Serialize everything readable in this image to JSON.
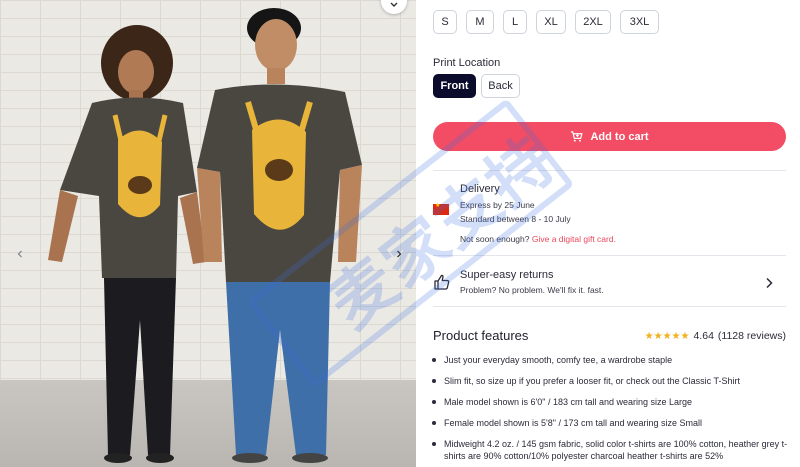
{
  "sizes": [
    "S",
    "M",
    "L",
    "XL",
    "2XL",
    "3XL"
  ],
  "print_location": {
    "label": "Print Location",
    "options": [
      "Front",
      "Back"
    ],
    "selected": "Front"
  },
  "cart": {
    "label": "Add to cart"
  },
  "delivery": {
    "title": "Delivery",
    "express": "Express by 25 June",
    "standard": "Standard between 8 - 10 July",
    "not_soon": "Not soon enough?",
    "gift_link": "Give a digital gift card."
  },
  "returns": {
    "title": "Super-easy returns",
    "subtitle": "Problem? No problem. We'll fix it. fast."
  },
  "features": {
    "title": "Product features",
    "rating": "4.64",
    "reviews": "(1128 reviews)",
    "stars": "★★★★★",
    "items": [
      "Just your everyday smooth, comfy tee, a wardrobe staple",
      "Slim fit, so size up if you prefer a looser fit, or check out the Classic T-Shirt",
      "Male model shown is 6'0\" / 183 cm tall and wearing size Large",
      "Female model shown is 5'8\" / 173 cm tall and wearing size Small",
      "Midweight 4.2 oz. / 145 gsm fabric, solid color t-shirts are 100% cotton, heather grey t-shirts are 90% cotton/10% polyester charcoal heather t-shirts are 52%"
    ]
  },
  "watermark": "麦家支持",
  "colors": {
    "accent": "#f24d64",
    "selected": "#0b0b2c",
    "link": "#e8485c",
    "star": "#f2b01e",
    "shirt": "#4a4740"
  },
  "icons": {
    "cart": "cart-icon",
    "returns": "thumbs-up-icon",
    "chevron": "chevron-right-icon",
    "prev": "chevron-left-icon",
    "next": "chevron-right-icon",
    "gallery_top": "chevron-down-icon",
    "flag": "china-flag-icon"
  }
}
